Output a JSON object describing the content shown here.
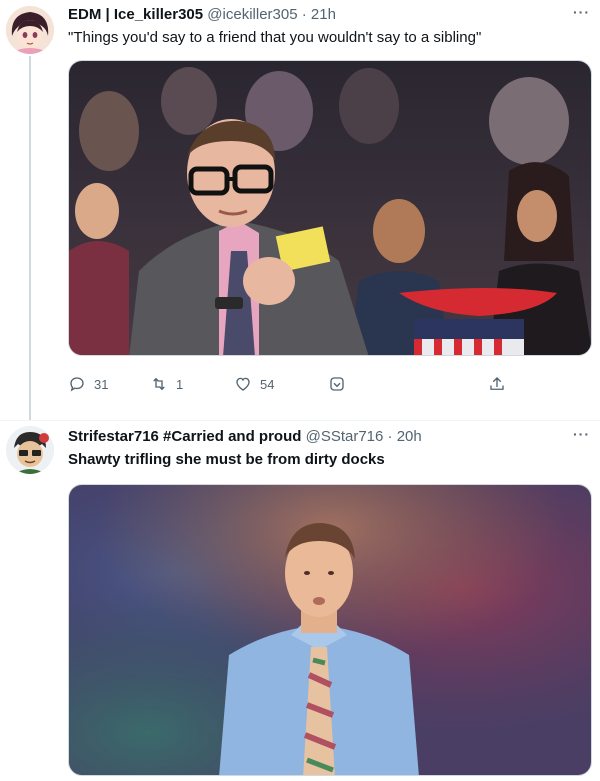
{
  "tweets": [
    {
      "display_name": "EDM | Ice_killer305",
      "handle_time": "@icekiller305 · 21h",
      "text": "\"Things you'd say to a friend that you wouldn't say to a sibling\"",
      "more": "···",
      "actions": {
        "replies": "31",
        "retweets": "1",
        "likes": "54"
      }
    },
    {
      "display_name": "Strifestar716 #Carried and proud",
      "handle_time": "@SStar716 · 20h",
      "text": "Shawty trifling she must be from dirty docks",
      "more": "···"
    }
  ],
  "icons": {
    "reply": "reply-icon",
    "retweet": "retweet-icon",
    "like": "like-icon",
    "moment": "moment-icon",
    "share": "share-icon"
  },
  "colors": {
    "muted": "#536471",
    "line": "#cfd9de"
  }
}
